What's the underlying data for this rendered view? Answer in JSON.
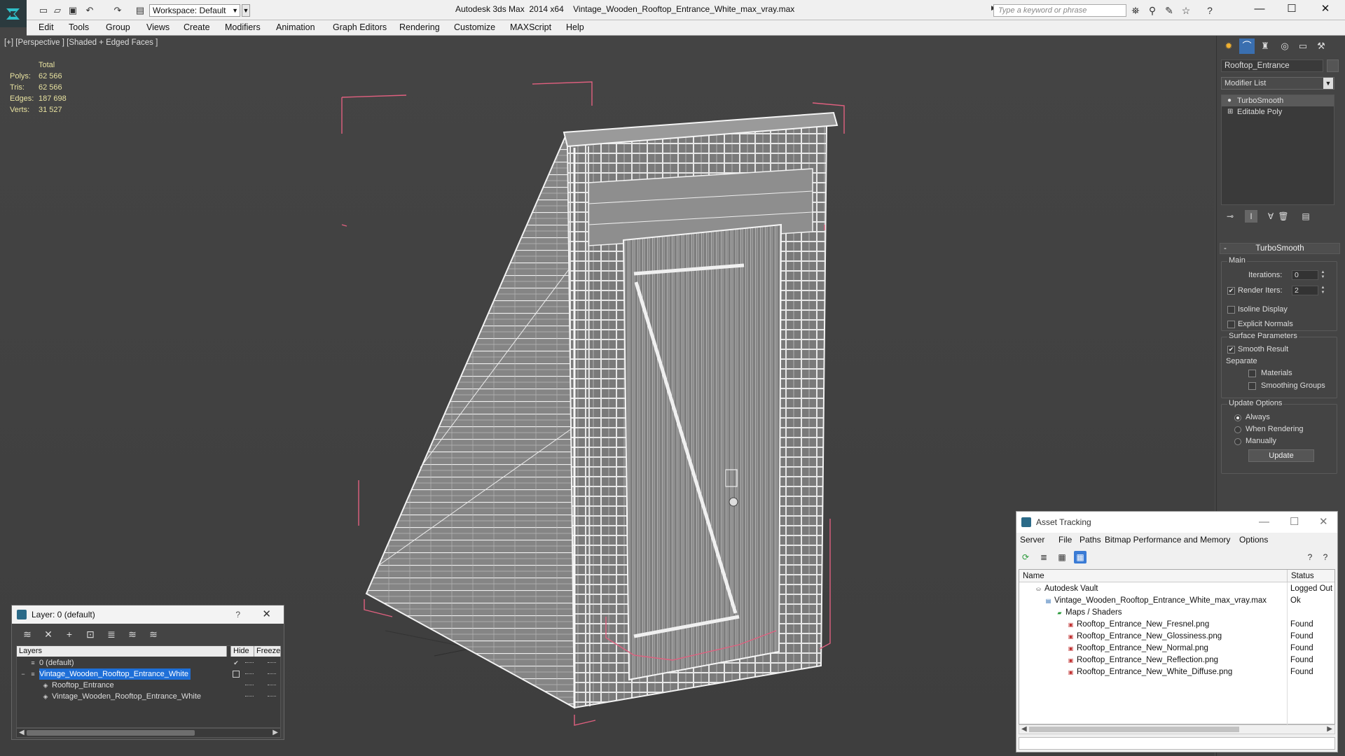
{
  "titlebar": {
    "app_title": "Autodesk 3ds Max  2014 x64",
    "file_title": "Vintage_Wooden_Rooftop_Entrance_White_max_vray.max",
    "workspace_label": "Workspace: Default",
    "search_placeholder": "Type a keyword or phrase",
    "icons": [
      "new-file-icon",
      "open-file-icon",
      "save-icon",
      "undo-icon",
      "redo-icon",
      "project-folder-icon",
      "binoculars-icon",
      "search-icon",
      "communication-icon",
      "favorites-star-icon",
      "help-icon"
    ],
    "window_buttons": {
      "minimize": "—",
      "maximize": "☐",
      "close": "✕"
    }
  },
  "menubar": {
    "items": [
      "Edit",
      "Tools",
      "Group",
      "Views",
      "Create",
      "Modifiers",
      "Animation",
      "Graph Editors",
      "Rendering",
      "Customize",
      "MAXScript",
      "Help"
    ]
  },
  "viewport": {
    "label": "[+] [Perspective ] [Shaded + Edged Faces ]",
    "stats": {
      "header": "Total",
      "rows": [
        {
          "label": "Polys:",
          "value": "62 566"
        },
        {
          "label": "Tris:",
          "value": "62 566"
        },
        {
          "label": "Edges:",
          "value": "187 698"
        },
        {
          "label": "Verts:",
          "value": "31 527"
        }
      ]
    },
    "colors": {
      "background": "#444444",
      "bbox": "#e0607f",
      "wire": "#e8e8e8",
      "wood": "#8a8a8a",
      "stats_text": "#e8e2a0"
    }
  },
  "command_panel": {
    "tabs": [
      "create-tab-icon",
      "modify-tab-icon",
      "hierarchy-tab-icon",
      "motion-tab-icon",
      "display-tab-icon",
      "utilities-tab-icon"
    ],
    "object_name": "Rooftop_Entrance",
    "modifier_list_label": "Modifier List",
    "stack": [
      {
        "label": "TurboSmooth",
        "selected": true
      },
      {
        "label": "Editable Poly",
        "selected": false
      }
    ],
    "rollout_title": "TurboSmooth",
    "main": {
      "title": "Main",
      "iterations_label": "Iterations:",
      "iterations_value": "0",
      "render_iters_label": "Render Iters:",
      "render_iters_value": "2",
      "render_iters_checked": true,
      "isoline_label": "Isoline Display",
      "explicit_normals_label": "Explicit Normals"
    },
    "surface": {
      "title": "Surface Parameters",
      "smooth_result_label": "Smooth Result",
      "separate_label": "Separate",
      "materials_label": "Materials",
      "smoothing_groups_label": "Smoothing Groups"
    },
    "update_options": {
      "title": "Update Options",
      "always_label": "Always",
      "when_rendering_label": "When Rendering",
      "manually_label": "Manually",
      "selected": "Always",
      "update_button": "Update"
    }
  },
  "layer_window": {
    "title": "Layer: 0 (default)",
    "help": "?",
    "close": "✕",
    "tools": [
      "create-layer-icon",
      "delete-layer-icon",
      "add-to-layer-icon",
      "select-in-layer-icon",
      "highlight-layer-icon",
      "hide-all-layers-icon",
      "freeze-all-layers-icon"
    ],
    "columns": [
      "Layers",
      "Hide",
      "Freeze"
    ],
    "rows": [
      {
        "name": "0 (default)",
        "indent": 0,
        "kind": "layer",
        "active": true
      },
      {
        "name": "Vintage_Wooden_Rooftop_Entrance_White",
        "indent": 0,
        "kind": "layer",
        "selected": true
      },
      {
        "name": "Rooftop_Entrance",
        "indent": 1,
        "kind": "object"
      },
      {
        "name": "Vintage_Wooden_Rooftop_Entrance_White",
        "indent": 1,
        "kind": "object"
      }
    ]
  },
  "asset_window": {
    "title": "Asset Tracking",
    "menu": [
      "Server",
      "File",
      "Paths",
      "Bitmap Performance and Memory",
      "Options"
    ],
    "columns": [
      "Name",
      "Status"
    ],
    "rows": [
      {
        "name": "Autodesk Vault",
        "status": "Logged Out",
        "indent": 1,
        "icon": "vault-icon"
      },
      {
        "name": "Vintage_Wooden_Rooftop_Entrance_White_max_vray.max",
        "status": "Ok",
        "indent": 2,
        "icon": "max-file-icon"
      },
      {
        "name": "Maps / Shaders",
        "status": "",
        "indent": 3,
        "icon": "maps-folder-icon"
      },
      {
        "name": "Rooftop_Entrance_New_Fresnel.png",
        "status": "Found",
        "indent": 4,
        "icon": "png-icon"
      },
      {
        "name": "Rooftop_Entrance_New_Glossiness.png",
        "status": "Found",
        "indent": 4,
        "icon": "png-icon"
      },
      {
        "name": "Rooftop_Entrance_New_Normal.png",
        "status": "Found",
        "indent": 4,
        "icon": "png-icon"
      },
      {
        "name": "Rooftop_Entrance_New_Reflection.png",
        "status": "Found",
        "indent": 4,
        "icon": "png-icon"
      },
      {
        "name": "Rooftop_Entrance_New_White_Diffuse.png",
        "status": "Found",
        "indent": 4,
        "icon": "png-icon"
      }
    ]
  }
}
